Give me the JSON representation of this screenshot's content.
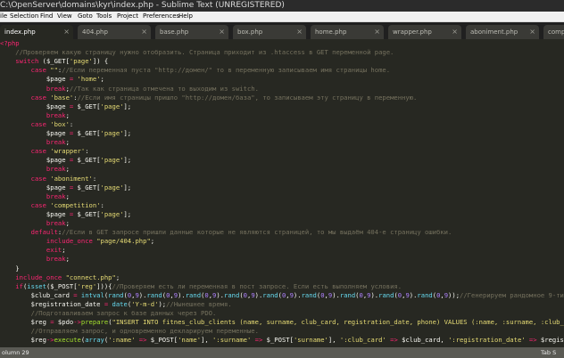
{
  "window": {
    "title": "C:\\OpenServer\\domains\\kyr\\index.php - Sublime Text (UNREGISTERED)"
  },
  "menu": [
    "ile",
    "Selection",
    "Find",
    "View",
    "Goto",
    "Tools",
    "Project",
    "Preferences",
    "Help"
  ],
  "tabs": [
    {
      "label": "index.php",
      "active": true
    },
    {
      "label": "404.php",
      "active": false
    },
    {
      "label": "base.php",
      "active": false
    },
    {
      "label": "box.php",
      "active": false
    },
    {
      "label": "home.php",
      "active": false
    },
    {
      "label": "wrapper.php",
      "active": false
    },
    {
      "label": "aboniment.php",
      "active": false
    },
    {
      "label": "comp",
      "active": false
    }
  ],
  "tab_close_glyph": "×",
  "editor": {
    "lines": [
      [
        [
          "k",
          "<?php"
        ]
      ],
      [
        [
          "c",
          "    //Проверяем какую страницу нужно отобразить. Страница приходит из .htaccess в GET переменной page."
        ]
      ],
      [
        [
          "k",
          "    switch "
        ],
        [
          "v",
          "("
        ],
        [
          "v",
          "$_GET"
        ],
        [
          "v",
          "["
        ],
        [
          "s",
          "'page'"
        ],
        [
          "v",
          "]) {"
        ]
      ],
      [
        [
          "k",
          "        case "
        ],
        [
          "s",
          "\"\""
        ],
        [
          "v",
          ":"
        ],
        [
          "c",
          "//Если переменная пуста \"http://домен/\" то в переменную записываем имя страницы home."
        ]
      ],
      [
        [
          "v",
          "            $page "
        ],
        [
          "k",
          "= "
        ],
        [
          "s",
          "'home'"
        ],
        [
          "v",
          ";"
        ]
      ],
      [
        [
          "k",
          "            break"
        ],
        [
          "v",
          ";"
        ],
        [
          "c",
          "//Так как страница отмечена то выходим из switch."
        ]
      ],
      [
        [
          "k",
          "        case "
        ],
        [
          "s",
          "'base'"
        ],
        [
          "v",
          ":"
        ],
        [
          "c",
          "//Если имя страницы пришло \"http://домен/база\", то записываем эту страницу в переменную."
        ]
      ],
      [
        [
          "v",
          "            $page "
        ],
        [
          "k",
          "= "
        ],
        [
          "v",
          "$_GET["
        ],
        [
          "s",
          "'page'"
        ],
        [
          "v",
          "];"
        ]
      ],
      [
        [
          "k",
          "            break"
        ],
        [
          "v",
          ";"
        ]
      ],
      [
        [
          "k",
          "        case "
        ],
        [
          "s",
          "'box'"
        ],
        [
          "v",
          ":"
        ]
      ],
      [
        [
          "v",
          "            $page "
        ],
        [
          "k",
          "= "
        ],
        [
          "v",
          "$_GET["
        ],
        [
          "s",
          "'page'"
        ],
        [
          "v",
          "];"
        ]
      ],
      [
        [
          "k",
          "            break"
        ],
        [
          "v",
          ";"
        ]
      ],
      [
        [
          "k",
          "        case "
        ],
        [
          "s",
          "'wrapper'"
        ],
        [
          "v",
          ":"
        ]
      ],
      [
        [
          "v",
          "            $page "
        ],
        [
          "k",
          "= "
        ],
        [
          "v",
          "$_GET["
        ],
        [
          "s",
          "'page'"
        ],
        [
          "v",
          "];"
        ]
      ],
      [
        [
          "k",
          "            break"
        ],
        [
          "v",
          ";"
        ]
      ],
      [
        [
          "k",
          "        case "
        ],
        [
          "s",
          "'aboniment'"
        ],
        [
          "v",
          ":"
        ]
      ],
      [
        [
          "v",
          "            $page "
        ],
        [
          "k",
          "= "
        ],
        [
          "v",
          "$_GET["
        ],
        [
          "s",
          "'page'"
        ],
        [
          "v",
          "];"
        ]
      ],
      [
        [
          "k",
          "            break"
        ],
        [
          "v",
          ";"
        ]
      ],
      [
        [
          "k",
          "        case "
        ],
        [
          "s",
          "'competition'"
        ],
        [
          "v",
          ":"
        ]
      ],
      [
        [
          "v",
          "            $page "
        ],
        [
          "k",
          "= "
        ],
        [
          "v",
          "$_GET["
        ],
        [
          "s",
          "'page'"
        ],
        [
          "v",
          "];"
        ]
      ],
      [
        [
          "k",
          "            break"
        ],
        [
          "v",
          ";"
        ]
      ],
      [
        [
          "k",
          "        default"
        ],
        [
          "v",
          ":"
        ],
        [
          "c",
          "//Если в GET запросе пришли данные которые не являются страницей, то мы выдаём 404-е страницу ошибки."
        ]
      ],
      [
        [
          "k",
          "            include_once "
        ],
        [
          "s",
          "\"page/404.php\""
        ],
        [
          "v",
          ";"
        ]
      ],
      [
        [
          "k",
          "            exit"
        ],
        [
          "v",
          ";"
        ]
      ],
      [
        [
          "k",
          "            break"
        ],
        [
          "v",
          ";"
        ]
      ],
      [
        [
          "v",
          "    }"
        ]
      ],
      [
        [
          "k",
          "    include_once "
        ],
        [
          "s",
          "\"connect.php\""
        ],
        [
          "v",
          ";"
        ]
      ],
      [
        [
          "k",
          "    if"
        ],
        [
          "v",
          "("
        ],
        [
          "f",
          "isset"
        ],
        [
          "v",
          "($_POST["
        ],
        [
          "s",
          "'reg'"
        ],
        [
          "v",
          "])){"
        ],
        [
          "c",
          "//Проверяем есть ли переменная в пост запросе. Если есть выполняем условия."
        ]
      ],
      [
        [
          "v",
          "        $club_card "
        ],
        [
          "k",
          "= "
        ],
        [
          "f",
          "intval"
        ],
        [
          "v",
          "("
        ],
        [
          "f",
          "rand"
        ],
        [
          "v",
          "("
        ],
        [
          "n",
          "0"
        ],
        [
          "v",
          ","
        ],
        [
          "n",
          "9"
        ],
        [
          "v",
          ")."
        ],
        [
          "f",
          "rand"
        ],
        [
          "v",
          "("
        ],
        [
          "n",
          "0"
        ],
        [
          "v",
          ","
        ],
        [
          "n",
          "9"
        ],
        [
          "v",
          ")."
        ],
        [
          "f",
          "rand"
        ],
        [
          "v",
          "("
        ],
        [
          "n",
          "0"
        ],
        [
          "v",
          ","
        ],
        [
          "n",
          "9"
        ],
        [
          "v",
          ")."
        ],
        [
          "f",
          "rand"
        ],
        [
          "v",
          "("
        ],
        [
          "n",
          "0"
        ],
        [
          "v",
          ","
        ],
        [
          "n",
          "9"
        ],
        [
          "v",
          ")."
        ],
        [
          "f",
          "rand"
        ],
        [
          "v",
          "("
        ],
        [
          "n",
          "0"
        ],
        [
          "v",
          ","
        ],
        [
          "n",
          "9"
        ],
        [
          "v",
          ")."
        ],
        [
          "f",
          "rand"
        ],
        [
          "v",
          "("
        ],
        [
          "n",
          "0"
        ],
        [
          "v",
          ","
        ],
        [
          "n",
          "9"
        ],
        [
          "v",
          ")."
        ],
        [
          "f",
          "rand"
        ],
        [
          "v",
          "("
        ],
        [
          "n",
          "0"
        ],
        [
          "v",
          ","
        ],
        [
          "n",
          "9"
        ],
        [
          "v",
          ")."
        ],
        [
          "f",
          "rand"
        ],
        [
          "v",
          "("
        ],
        [
          "n",
          "0"
        ],
        [
          "v",
          ","
        ],
        [
          "n",
          "9"
        ],
        [
          "v",
          ")."
        ],
        [
          "f",
          "rand"
        ],
        [
          "v",
          "("
        ],
        [
          "n",
          "0"
        ],
        [
          "v",
          ","
        ],
        [
          "n",
          "9"
        ],
        [
          "v",
          "));"
        ],
        [
          "c",
          "//Генерируем рандомное 9-ти"
        ]
      ],
      [
        [
          "v",
          "        $registration_date "
        ],
        [
          "k",
          "= "
        ],
        [
          "f",
          "date"
        ],
        [
          "v",
          "("
        ],
        [
          "s",
          "'Y-m-d'"
        ],
        [
          "v",
          ");"
        ],
        [
          "c",
          "//Нынешнее время."
        ]
      ],
      [
        [
          "c",
          "        //Подготавливаем запрос к базе данных через PDO."
        ]
      ],
      [
        [
          "v",
          "        $reg "
        ],
        [
          "k",
          "= "
        ],
        [
          "v",
          "$pdo"
        ],
        [
          "k",
          "->"
        ],
        [
          "fn",
          "prepare"
        ],
        [
          "v",
          "("
        ],
        [
          "s",
          "\"INSERT INTO fitnes_club_clients (name, surname, club_card, registration_date, phone) VALUES (:name, :surname, :club_"
        ]
      ],
      [
        [
          "c",
          "        //Отправляем запрос, и одновременно декларируем переменные."
        ]
      ],
      [
        [
          "v",
          "        $reg"
        ],
        [
          "k",
          "->"
        ],
        [
          "fn",
          "execute"
        ],
        [
          "v",
          "("
        ],
        [
          "f",
          "array"
        ],
        [
          "v",
          "("
        ],
        [
          "s",
          "':name'"
        ],
        [
          "k",
          " => "
        ],
        [
          "v",
          "$_POST["
        ],
        [
          "s",
          "'name'"
        ],
        [
          "v",
          "], "
        ],
        [
          "s",
          "':surname'"
        ],
        [
          "k",
          " => "
        ],
        [
          "v",
          "$_POST["
        ],
        [
          "s",
          "'surname'"
        ],
        [
          "v",
          "], "
        ],
        [
          "s",
          "':club_card'"
        ],
        [
          "k",
          " => "
        ],
        [
          "v",
          "$club_card, "
        ],
        [
          "s",
          "':registration_date'"
        ],
        [
          "k",
          " => "
        ],
        [
          "v",
          "$regis"
        ]
      ]
    ]
  },
  "status": {
    "left": "olumn 29",
    "right": "Tab S"
  }
}
